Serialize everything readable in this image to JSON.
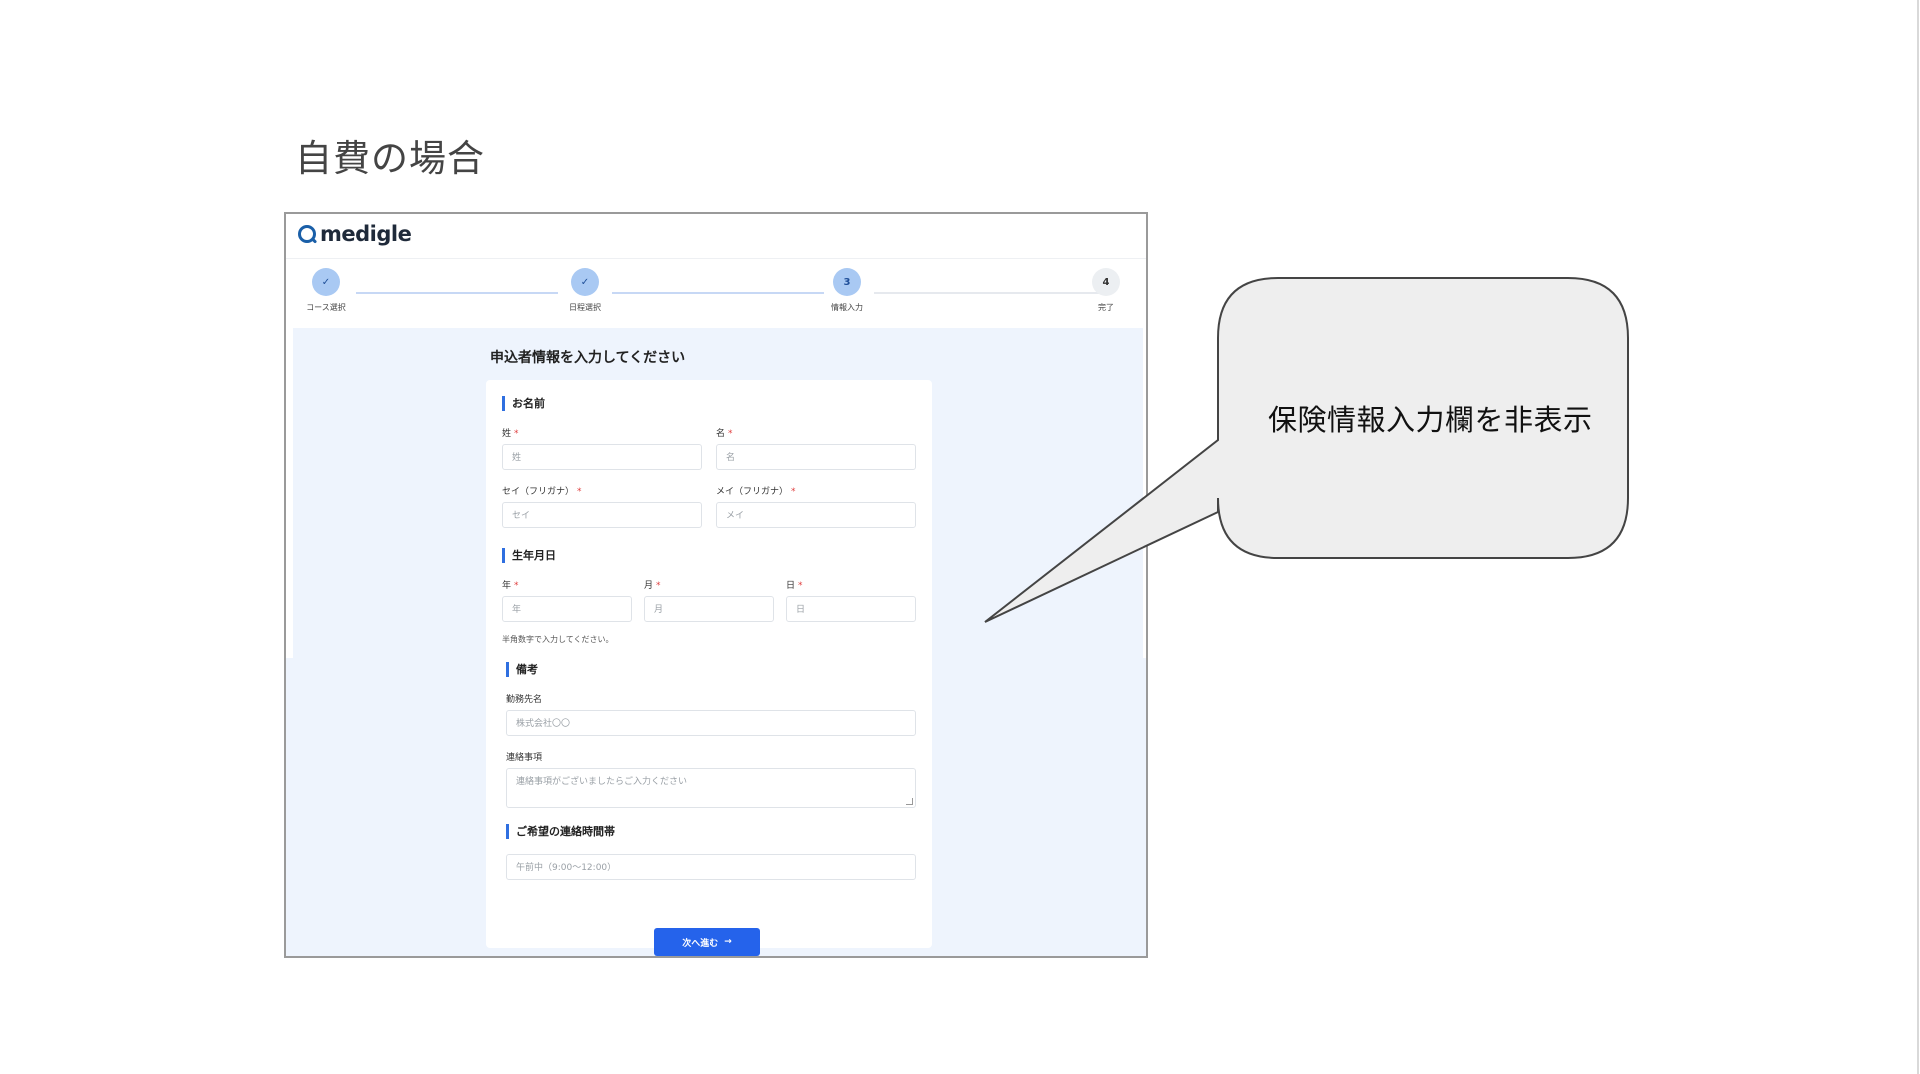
{
  "slide": {
    "title": "自費の場合"
  },
  "app": {
    "logo_text": "medigle"
  },
  "stepper": {
    "steps": [
      {
        "label": "コース選択",
        "mark": "✓",
        "state": "done"
      },
      {
        "label": "日程選択",
        "mark": "✓",
        "state": "done"
      },
      {
        "label": "情報入力",
        "mark": "3",
        "state": "current"
      },
      {
        "label": "完了",
        "mark": "4",
        "state": "todo"
      }
    ]
  },
  "form": {
    "heading": "申込者情報を入力してください",
    "name_section": {
      "title": "お名前",
      "last_name": {
        "label": "姓",
        "placeholder": "姓"
      },
      "first_name": {
        "label": "名",
        "placeholder": "名"
      },
      "last_kana": {
        "label": "セイ（フリガナ）",
        "placeholder": "セイ"
      },
      "first_kana": {
        "label": "メイ（フリガナ）",
        "placeholder": "メイ"
      }
    },
    "birth_section": {
      "title": "生年月日",
      "year": {
        "label": "年",
        "placeholder": "年"
      },
      "month": {
        "label": "月",
        "placeholder": "月"
      },
      "day": {
        "label": "日",
        "placeholder": "日"
      },
      "hint": "半角数字で入力してください。"
    },
    "notes_section": {
      "title": "備考",
      "workplace": {
        "label": "勤務先名",
        "placeholder": "株式会社〇〇"
      },
      "contact_notes": {
        "label": "連絡事項",
        "placeholder": "連絡事項がございましたらご入力ください"
      }
    },
    "contact_time_section": {
      "title": "ご希望の連絡時間帯",
      "selected": "午前中（9:00〜12:00）"
    },
    "next_button": {
      "label": "次へ進む",
      "arrow": "→"
    },
    "required_mark": "*"
  },
  "callout": {
    "text": "保険情報入力欄を非表示"
  },
  "colors": {
    "primary": "#2563eb",
    "step_done": "#a9c9f3",
    "page_bg": "#eef4fd",
    "required": "#e04040"
  }
}
